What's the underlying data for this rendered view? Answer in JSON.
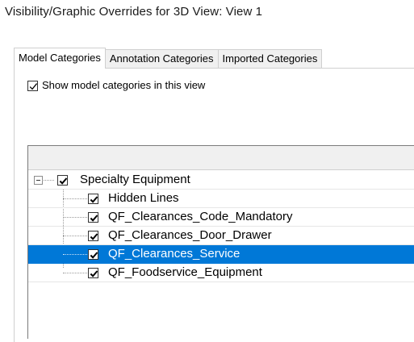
{
  "window": {
    "title": "Visibility/Graphic Overrides for 3D View: View 1"
  },
  "tabs": [
    {
      "label": "Model Categories",
      "active": true
    },
    {
      "label": "Annotation Categories",
      "active": false
    },
    {
      "label": "Imported Categories",
      "active": false
    }
  ],
  "show_categories": {
    "label": "Show model categories in this view",
    "checked": true
  },
  "tree": {
    "parent": {
      "label": "Specialty Equipment",
      "checked": true,
      "expanded": true
    },
    "children": [
      {
        "label": "Hidden Lines",
        "checked": true,
        "selected": false
      },
      {
        "label": "QF_Clearances_Code_Mandatory",
        "checked": true,
        "selected": false
      },
      {
        "label": "QF_Clearances_Door_Drawer",
        "checked": true,
        "selected": false
      },
      {
        "label": "QF_Clearances_Service",
        "checked": true,
        "selected": true
      },
      {
        "label": "QF_Foodservice_Equipment",
        "checked": true,
        "selected": false
      }
    ]
  },
  "colors": {
    "selection": "#0078d7",
    "tab_inactive_bg": "#f0f0f0",
    "header_bg": "#f0f0f0"
  }
}
